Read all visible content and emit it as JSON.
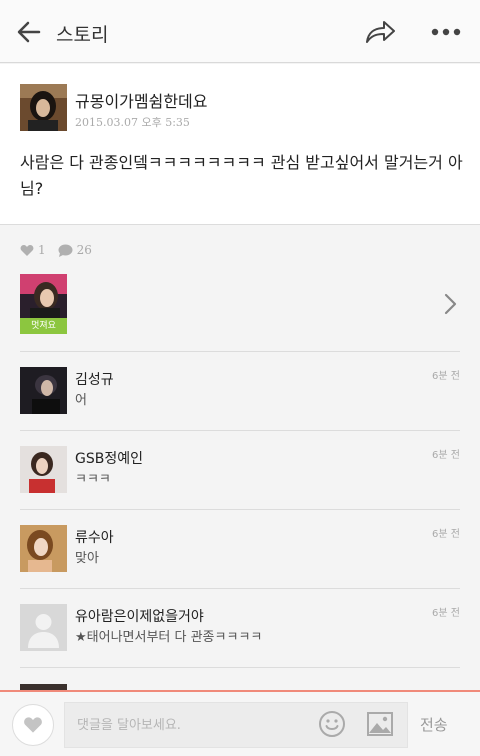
{
  "header": {
    "title": "스토리"
  },
  "post": {
    "author": "규몽이가멤쉼한데요",
    "date": "2015.03.07 오후 5:35",
    "body": "사람은 다 관종인뎈ㅋㅋㅋㅋㅋㅋㅋㅋ 관심 받고싶어서 말거는거 아님?"
  },
  "stats": {
    "likes": "1",
    "comments": "26"
  },
  "likers": {
    "badge": "멋져요"
  },
  "comments": [
    {
      "name": "김성규",
      "text": "어",
      "time": "6분 전"
    },
    {
      "name": "GSB정예인",
      "text": "ㅋㅋㅋ",
      "time": "6분 전"
    },
    {
      "name": "류수아",
      "text": "맞아",
      "time": "6분 전"
    },
    {
      "name": "유아람은이제없을거야",
      "text": "★태어나면서부터 다 관종ㅋㅋㅋㅋ",
      "time": "6분 전"
    }
  ],
  "composer": {
    "placeholder": "댓글을 달아보세요.",
    "send_label": "전송"
  },
  "colors": {
    "accent": "#f08a7a",
    "badge": "#8cc63f"
  }
}
